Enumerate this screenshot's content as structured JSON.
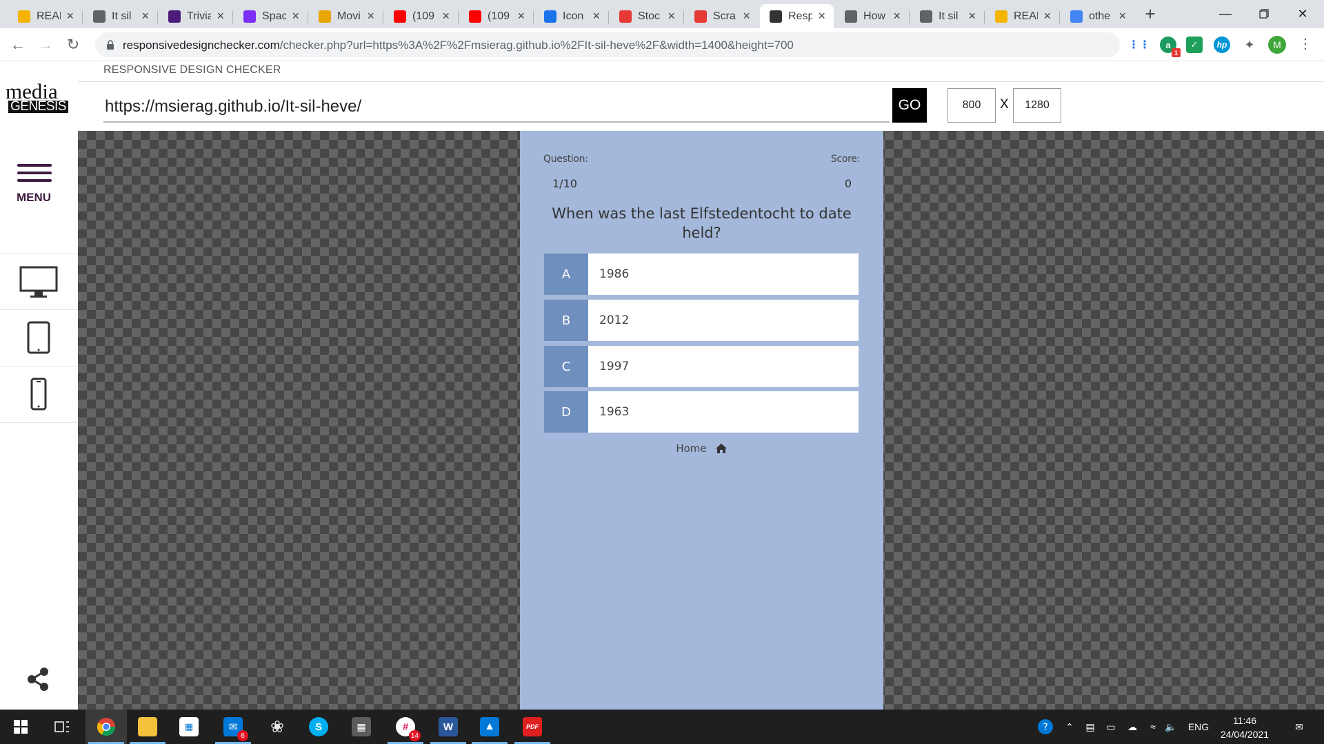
{
  "browser": {
    "tabs": [
      {
        "label": "REAL",
        "icon": "google-colored-icon",
        "color": "#f4b400"
      },
      {
        "label": "It sil",
        "icon": "globe-icon",
        "color": "#5f6368"
      },
      {
        "label": "Trivia",
        "icon": "trivia-app-icon",
        "color": "#4b1c7a"
      },
      {
        "label": "Space",
        "icon": "b-letter-icon",
        "color": "#7b2ff7"
      },
      {
        "label": "Movi",
        "icon": "m-letter-icon",
        "color": "#e8a600"
      },
      {
        "label": "(109",
        "icon": "youtube-icon",
        "color": "#ff0000"
      },
      {
        "label": "(109",
        "icon": "youtube-icon",
        "color": "#ff0000"
      },
      {
        "label": "Icon",
        "icon": "flag-icon",
        "color": "#1a73e8"
      },
      {
        "label": "Stoc",
        "icon": "red-square-icon",
        "color": "#e53935"
      },
      {
        "label": "Scra",
        "icon": "red-square-icon",
        "color": "#e53935"
      },
      {
        "label": "Resp",
        "icon": "responsive-checker-icon",
        "color": "#333333",
        "active": true
      },
      {
        "label": "How",
        "icon": "globe-icon",
        "color": "#5f6368"
      },
      {
        "label": "It sil",
        "icon": "globe-icon",
        "color": "#5f6368"
      },
      {
        "label": "REAL",
        "icon": "google-colored-icon",
        "color": "#f4b400"
      },
      {
        "label": "othe",
        "icon": "google-g-icon",
        "color": "#4285f4"
      }
    ],
    "url_host": "responsivedesignchecker.com",
    "url_path": "/checker.php?url=https%3A%2F%2Fmsierag.github.io%2FIt-sil-heve%2F&width=1400&height=700",
    "profile_initial": "M",
    "extension_badge": "1"
  },
  "site": {
    "title": "RESPONSIVE DESIGN CHECKER",
    "logo_top": "media",
    "logo_bottom": "GENESIS",
    "url_value": "https://msierag.github.io/It-sil-heve/",
    "go_label": "GO",
    "width_value": "800",
    "times_label": "X",
    "height_value": "1280",
    "menu_label": "MENU"
  },
  "quiz": {
    "question_label": "Question:",
    "score_label": "Score:",
    "counter": "1/10",
    "score": "0",
    "question": "When was the last Elfstedentocht to date held?",
    "choices": [
      {
        "prefix": "A",
        "text": "1986"
      },
      {
        "prefix": "B",
        "text": "2012"
      },
      {
        "prefix": "C",
        "text": "1997"
      },
      {
        "prefix": "D",
        "text": "1963"
      }
    ],
    "home_label": "Home"
  },
  "taskbar": {
    "mail_badge": "6",
    "slack_badge": "14",
    "lang": "ENG",
    "time": "11:46",
    "date": "24/04/2021"
  },
  "colors": {
    "quiz_bg": "#a3b8da",
    "choice_prefix_bg": "#6f8fbf",
    "menu_color": "#3e1c41",
    "go_bg": "#000000"
  }
}
